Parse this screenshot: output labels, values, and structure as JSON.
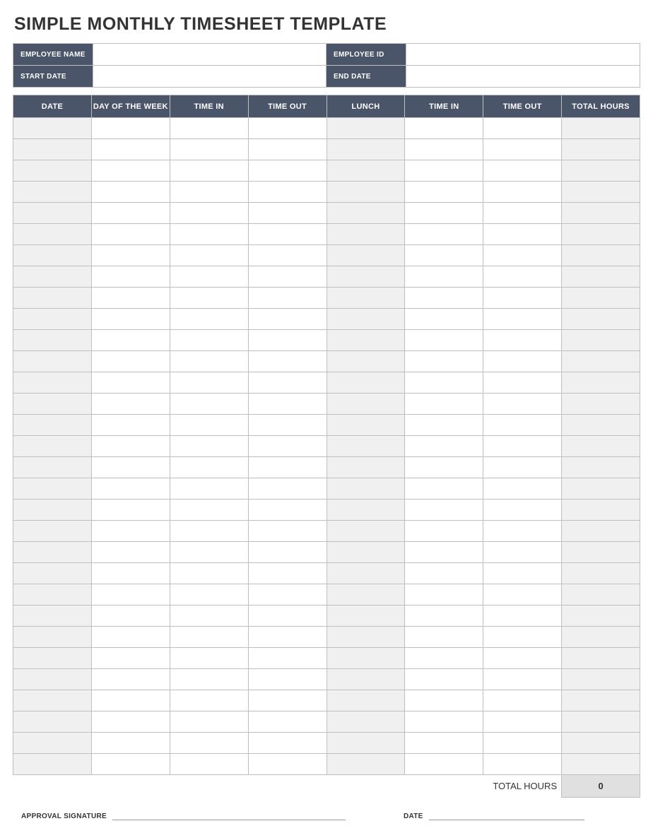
{
  "title": "SIMPLE MONTHLY TIMESHEET TEMPLATE",
  "info": {
    "employee_name_label": "EMPLOYEE NAME",
    "employee_name_value": "",
    "employee_id_label": "EMPLOYEE ID",
    "employee_id_value": "",
    "start_date_label": "START DATE",
    "start_date_value": "",
    "end_date_label": "END DATE",
    "end_date_value": ""
  },
  "columns": {
    "date": "DATE",
    "day_of_week": "DAY OF THE WEEK",
    "time_in_1": "TIME IN",
    "time_out_1": "TIME OUT",
    "lunch": "LUNCH",
    "time_in_2": "TIME IN",
    "time_out_2": "TIME OUT",
    "total_hours": "TOTAL HOURS"
  },
  "rows": [
    {
      "date": "",
      "day": "",
      "in1": "",
      "out1": "",
      "lunch": "",
      "in2": "",
      "out2": "",
      "total": ""
    },
    {
      "date": "",
      "day": "",
      "in1": "",
      "out1": "",
      "lunch": "",
      "in2": "",
      "out2": "",
      "total": ""
    },
    {
      "date": "",
      "day": "",
      "in1": "",
      "out1": "",
      "lunch": "",
      "in2": "",
      "out2": "",
      "total": ""
    },
    {
      "date": "",
      "day": "",
      "in1": "",
      "out1": "",
      "lunch": "",
      "in2": "",
      "out2": "",
      "total": ""
    },
    {
      "date": "",
      "day": "",
      "in1": "",
      "out1": "",
      "lunch": "",
      "in2": "",
      "out2": "",
      "total": ""
    },
    {
      "date": "",
      "day": "",
      "in1": "",
      "out1": "",
      "lunch": "",
      "in2": "",
      "out2": "",
      "total": ""
    },
    {
      "date": "",
      "day": "",
      "in1": "",
      "out1": "",
      "lunch": "",
      "in2": "",
      "out2": "",
      "total": ""
    },
    {
      "date": "",
      "day": "",
      "in1": "",
      "out1": "",
      "lunch": "",
      "in2": "",
      "out2": "",
      "total": ""
    },
    {
      "date": "",
      "day": "",
      "in1": "",
      "out1": "",
      "lunch": "",
      "in2": "",
      "out2": "",
      "total": ""
    },
    {
      "date": "",
      "day": "",
      "in1": "",
      "out1": "",
      "lunch": "",
      "in2": "",
      "out2": "",
      "total": ""
    },
    {
      "date": "",
      "day": "",
      "in1": "",
      "out1": "",
      "lunch": "",
      "in2": "",
      "out2": "",
      "total": ""
    },
    {
      "date": "",
      "day": "",
      "in1": "",
      "out1": "",
      "lunch": "",
      "in2": "",
      "out2": "",
      "total": ""
    },
    {
      "date": "",
      "day": "",
      "in1": "",
      "out1": "",
      "lunch": "",
      "in2": "",
      "out2": "",
      "total": ""
    },
    {
      "date": "",
      "day": "",
      "in1": "",
      "out1": "",
      "lunch": "",
      "in2": "",
      "out2": "",
      "total": ""
    },
    {
      "date": "",
      "day": "",
      "in1": "",
      "out1": "",
      "lunch": "",
      "in2": "",
      "out2": "",
      "total": ""
    },
    {
      "date": "",
      "day": "",
      "in1": "",
      "out1": "",
      "lunch": "",
      "in2": "",
      "out2": "",
      "total": ""
    },
    {
      "date": "",
      "day": "",
      "in1": "",
      "out1": "",
      "lunch": "",
      "in2": "",
      "out2": "",
      "total": ""
    },
    {
      "date": "",
      "day": "",
      "in1": "",
      "out1": "",
      "lunch": "",
      "in2": "",
      "out2": "",
      "total": ""
    },
    {
      "date": "",
      "day": "",
      "in1": "",
      "out1": "",
      "lunch": "",
      "in2": "",
      "out2": "",
      "total": ""
    },
    {
      "date": "",
      "day": "",
      "in1": "",
      "out1": "",
      "lunch": "",
      "in2": "",
      "out2": "",
      "total": ""
    },
    {
      "date": "",
      "day": "",
      "in1": "",
      "out1": "",
      "lunch": "",
      "in2": "",
      "out2": "",
      "total": ""
    },
    {
      "date": "",
      "day": "",
      "in1": "",
      "out1": "",
      "lunch": "",
      "in2": "",
      "out2": "",
      "total": ""
    },
    {
      "date": "",
      "day": "",
      "in1": "",
      "out1": "",
      "lunch": "",
      "in2": "",
      "out2": "",
      "total": ""
    },
    {
      "date": "",
      "day": "",
      "in1": "",
      "out1": "",
      "lunch": "",
      "in2": "",
      "out2": "",
      "total": ""
    },
    {
      "date": "",
      "day": "",
      "in1": "",
      "out1": "",
      "lunch": "",
      "in2": "",
      "out2": "",
      "total": ""
    },
    {
      "date": "",
      "day": "",
      "in1": "",
      "out1": "",
      "lunch": "",
      "in2": "",
      "out2": "",
      "total": ""
    },
    {
      "date": "",
      "day": "",
      "in1": "",
      "out1": "",
      "lunch": "",
      "in2": "",
      "out2": "",
      "total": ""
    },
    {
      "date": "",
      "day": "",
      "in1": "",
      "out1": "",
      "lunch": "",
      "in2": "",
      "out2": "",
      "total": ""
    },
    {
      "date": "",
      "day": "",
      "in1": "",
      "out1": "",
      "lunch": "",
      "in2": "",
      "out2": "",
      "total": ""
    },
    {
      "date": "",
      "day": "",
      "in1": "",
      "out1": "",
      "lunch": "",
      "in2": "",
      "out2": "",
      "total": ""
    },
    {
      "date": "",
      "day": "",
      "in1": "",
      "out1": "",
      "lunch": "",
      "in2": "",
      "out2": "",
      "total": ""
    }
  ],
  "footer": {
    "total_hours_label": "TOTAL HOURS",
    "total_hours_value": "0",
    "approval_signature_label": "APPROVAL SIGNATURE",
    "date_label": "DATE"
  }
}
